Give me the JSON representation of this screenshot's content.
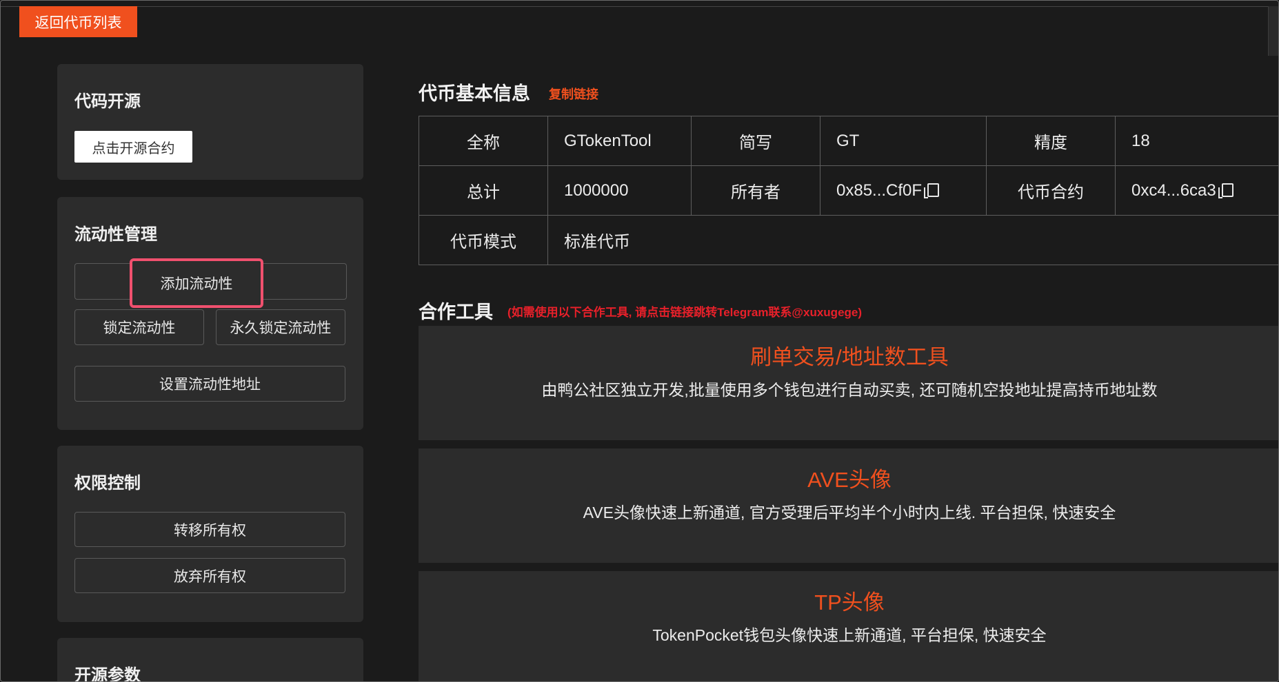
{
  "header": {
    "back_label": "返回代币列表"
  },
  "sidebar": {
    "open_source": {
      "title": "代码开源",
      "button": "点击开源合约"
    },
    "liquidity": {
      "title": "流动性管理",
      "add": "添加流动性",
      "lock": "锁定流动性",
      "lock_forever": "永久锁定流动性",
      "set_address": "设置流动性地址"
    },
    "permission": {
      "title": "权限控制",
      "transfer": "转移所有权",
      "renounce": "放弃所有权"
    },
    "params": {
      "title": "开源参数"
    }
  },
  "token_info": {
    "title": "代币基本信息",
    "copy_link": "复制链接",
    "rows": [
      [
        {
          "label": "全称",
          "value": "GTokenTool"
        },
        {
          "label": "简写",
          "value": "GT"
        },
        {
          "label": "精度",
          "value": "18"
        }
      ],
      [
        {
          "label": "总计",
          "value": "1000000"
        },
        {
          "label": "所有者",
          "value": "0x85...Cf0F"
        },
        {
          "label": "代币合约",
          "value": "0xc4...6ca3"
        }
      ],
      [
        {
          "label": "代币模式",
          "value": "标准代币"
        }
      ]
    ]
  },
  "tools": {
    "title": "合作工具",
    "note": "(如需使用以下合作工具, 请点击链接跳转Telegram联系@xuxugege)",
    "items": [
      {
        "name": "刷单交易/地址数工具",
        "desc": "由鸭公社区独立开发,批量使用多个钱包进行自动买卖, 还可随机空投地址提高持币地址数"
      },
      {
        "name": "AVE头像",
        "desc": "AVE头像快速上新通道, 官方受理后平均半个小时内上线. 平台担保, 快速安全"
      },
      {
        "name": "TP头像",
        "desc": "TokenPocket钱包头像快速上新通道, 平台担保, 快速安全"
      }
    ]
  },
  "colors": {
    "accent": "#f0501e",
    "highlight": "#f0506e",
    "note_red": "#e8202a",
    "card_bg": "#2c2c2c",
    "page_bg": "#1b1b1b"
  }
}
